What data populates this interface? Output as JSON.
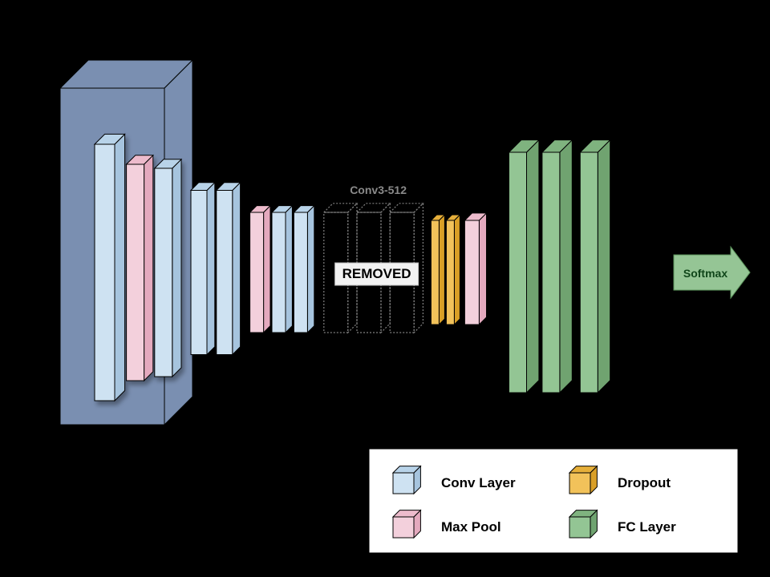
{
  "colors": {
    "plane": "#7A8FB1",
    "conv_f": "#CEE2F2",
    "conv_t": "#B8D3E9",
    "conv_s": "#A6C4DE",
    "pool_f": "#F3D0DC",
    "pool_t": "#EDBBCC",
    "pool_s": "#E4A9BE",
    "rem_f": "#D9D9D9",
    "rem_t": "#C7C7C7",
    "rem_s": "#B9B9B9",
    "drop_f": "#F2C25A",
    "drop_t": "#E6AF3A",
    "drop_s": "#D99F28",
    "fc_f": "#93C594",
    "fc_t": "#7FB37F",
    "fc_s": "#6FA370",
    "arrow": "#95C595"
  },
  "labels": {
    "removed_section": "Conv3-512",
    "removed_badge": "REMOVED",
    "output": "Softmax",
    "legend": {
      "conv": "Conv Layer",
      "drop": "Dropout",
      "pool": "Max Pool",
      "fc": "FC Layer"
    }
  },
  "architecture": {
    "input": "image plane",
    "blocks": [
      {
        "type": "conv"
      },
      {
        "type": "maxpool"
      },
      {
        "type": "conv"
      },
      {
        "type": "conv"
      },
      {
        "type": "maxpool"
      },
      {
        "type": "conv"
      },
      {
        "type": "conv"
      },
      {
        "type": "removed",
        "name": "Conv3-512"
      },
      {
        "type": "removed",
        "name": "Conv3-512"
      },
      {
        "type": "removed",
        "name": "Conv3-512"
      },
      {
        "type": "dropout"
      },
      {
        "type": "maxpool"
      },
      {
        "type": "fc"
      },
      {
        "type": "fc"
      },
      {
        "type": "fc"
      }
    ],
    "output": "Softmax"
  }
}
